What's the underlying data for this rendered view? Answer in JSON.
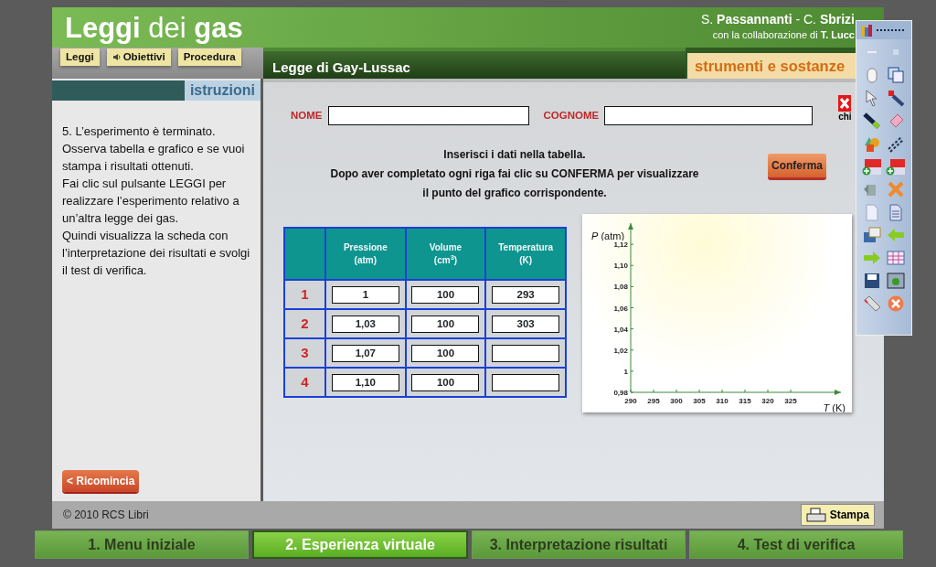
{
  "header": {
    "title": "**Leggi** dei **gas**",
    "authors": "S. **Passannanti** - C. **Sbrizi**",
    "credits": "con la collaborazione di **T. Lucc**"
  },
  "nav_buttons": [
    {
      "label": "Leggi",
      "kind": "plain"
    },
    {
      "label": "Obiettivi",
      "kind": "audio"
    },
    {
      "label": "Procedura",
      "kind": "plain"
    }
  ],
  "section_title": "Legge di Gay-Lussac",
  "side_tab": "strumenti e sostanze",
  "sidebar": {
    "heading": "istruzioni",
    "paragraphs": [
      "5. L’esperimento è terminato.",
      "Osserva tabella e grafico e se vuoi stampa i risultati ottenuti.",
      "Fai clic sul pulsante LEGGI per realizzare l’esperimento relativo a un’altra legge dei gas.",
      "Quindi visualizza la scheda con l’interpretazione dei risultati e svolgi il test di verifica."
    ],
    "restart_button": "< Ricomincia"
  },
  "form": {
    "fields": [
      {
        "label": "NOME"
      },
      {
        "label": "COGNOME"
      }
    ],
    "close_label": "chi"
  },
  "instructions": [
    "Inserisci i dati nella tabella.",
    "Dopo aver completato ogni riga fai clic su CONFERMA per visualizzare",
    "il punto del grafico corrispondente."
  ],
  "confirm_button": "Conferma",
  "table": {
    "columns": [
      {
        "name": "Pressione",
        "unit": "(atm)"
      },
      {
        "name": "Volume",
        "unit": "(cm$^{3}$)"
      },
      {
        "name": "Temperatura",
        "unit": "(K)"
      }
    ],
    "rows": [
      {
        "index": "1",
        "pressure": "1",
        "volume": "100",
        "temperature": "293"
      },
      {
        "index": "2",
        "pressure": "1,03",
        "volume": "100",
        "temperature": "303"
      },
      {
        "index": "3",
        "pressure": "1,07",
        "volume": "100"
      },
      {
        "index": "4",
        "pressure": "1,10",
        "volume": "100"
      }
    ]
  },
  "chart": {
    "chart_data": {
      "type": "scatter",
      "xlabel": "*T* (K)",
      "ylabel": "*P* (atm)",
      "xlim": [
        290,
        336
      ],
      "ylim": [
        0.98,
        1.14
      ],
      "xticks": [
        290,
        295,
        300,
        305,
        310,
        315,
        320,
        325
      ],
      "yticks": [
        {
          "value": 0.98,
          "label": "0,98"
        },
        {
          "value": 1,
          "label": "1"
        },
        {
          "value": 1.02,
          "label": "1,02"
        },
        {
          "value": 1.04,
          "label": "1,04"
        },
        {
          "value": 1.06,
          "label": "1,06"
        },
        {
          "value": 1.08,
          "label": "1,08"
        },
        {
          "value": 1.1,
          "label": "1,10"
        },
        {
          "value": 1.12,
          "label": "1,12"
        }
      ]
    }
  },
  "footer": {
    "copyright": "© 2010 RCS Libri",
    "print_button": "Stampa"
  },
  "steps": [
    {
      "label": "1. Menu iniziale",
      "selected": false
    },
    {
      "label": "2. Esperienza virtuale",
      "selected": true
    },
    {
      "label": "3. Interpretazione risultati",
      "selected": false
    },
    {
      "label": "4. Test di verifica",
      "selected": false
    }
  ]
}
